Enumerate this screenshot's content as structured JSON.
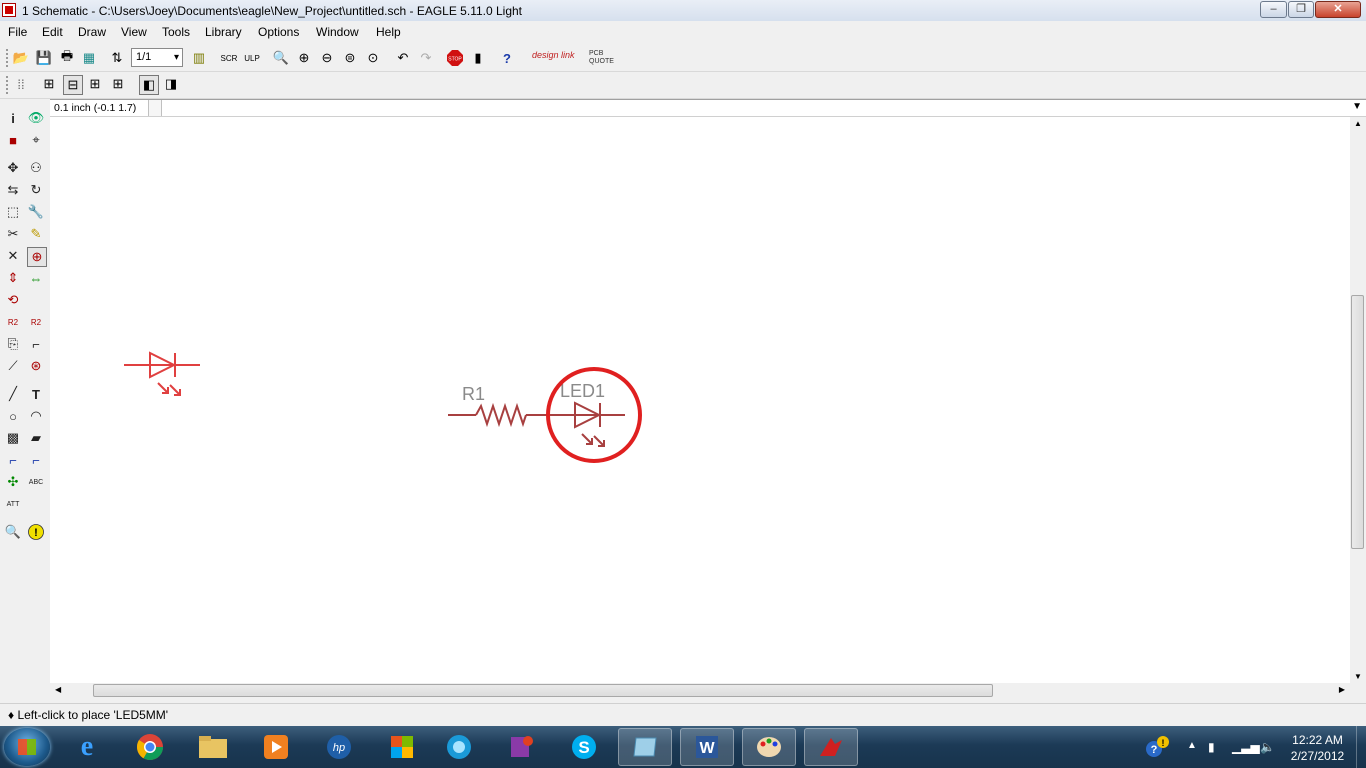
{
  "window": {
    "title": "1 Schematic - C:\\Users\\Joey\\Documents\\eagle\\New_Project\\untitled.sch - EAGLE 5.11.0 Light",
    "minimize": "–",
    "maximize": "❐",
    "close": "✕"
  },
  "menu": [
    "File",
    "Edit",
    "Draw",
    "View",
    "Tools",
    "Library",
    "Options",
    "Window",
    "Help"
  ],
  "toolbar": {
    "sheet_select": "1/1",
    "designlink_label": "design link",
    "pcbquote_label": "PCB QUOTE"
  },
  "coord": {
    "value": "0.1 inch (-0.1 1.7)",
    "command": ""
  },
  "schematic": {
    "resistor_name": "R1",
    "led_name": "LED1",
    "highlight_color": "#e02020",
    "part_color": "#a84040",
    "ghost_color": "#e04040",
    "label_color": "#8a8a8a"
  },
  "status": {
    "message": "♦ Left-click to place 'LED5MM'"
  },
  "taskbar": {
    "apps": [
      "internet-explorer",
      "chrome",
      "file-explorer",
      "media-player",
      "hp",
      "office",
      "ie-alt",
      "onenote",
      "skype",
      "virtual-pc",
      "word",
      "paint",
      "eagle"
    ]
  },
  "clock": {
    "time": "12:22 AM",
    "date": "2/27/2012"
  }
}
